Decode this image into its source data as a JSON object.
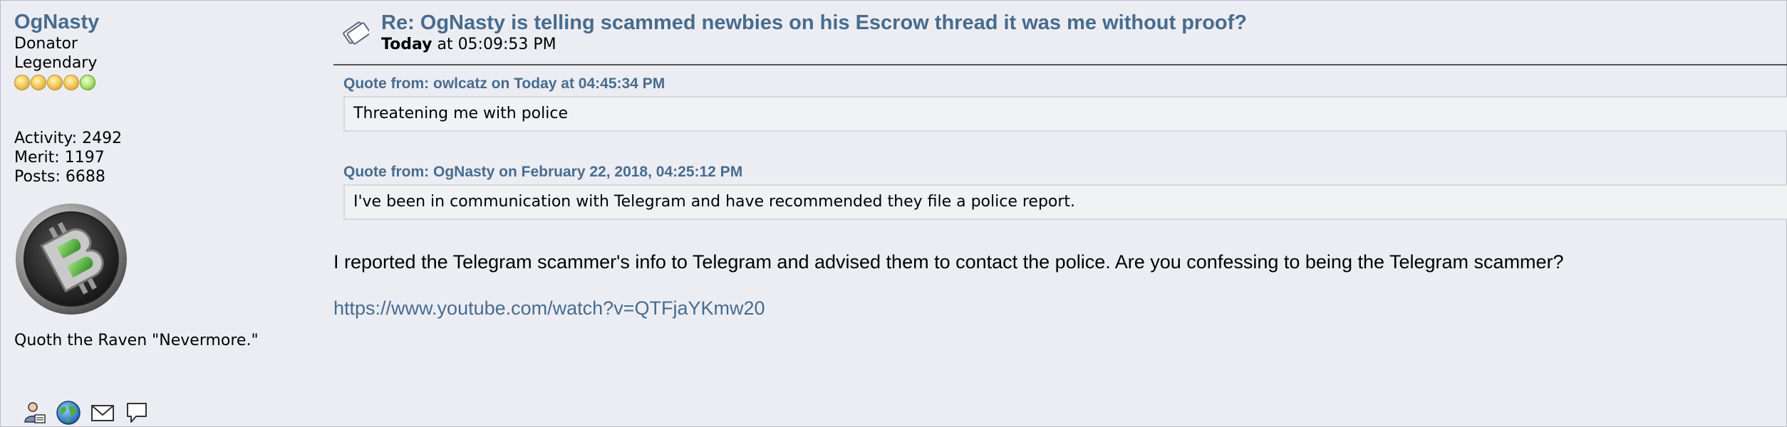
{
  "poster": {
    "name": "OgNasty",
    "group": "Donator",
    "rank": "Legendary",
    "rank_icons": [
      "gold-star-icon",
      "gold-star-icon",
      "gold-star-icon",
      "gold-star-icon",
      "green-star-icon"
    ],
    "activity": "Activity: 2492",
    "merit": "Merit: 1197",
    "posts": "Posts: 6688",
    "avatar_icon": "bitcoin-avatar",
    "personal_text": "Quoth the Raven \"Nevermore.\"",
    "action_icons": [
      "profile-icon",
      "website-globe-icon",
      "email-envelope-icon",
      "message-bubble-icon"
    ]
  },
  "post": {
    "icon": "post-xx-icon",
    "subject": "Re: OgNasty is telling scammed newbies on his Escrow thread it was me without proof?",
    "time_bold": "Today",
    "time_rest": " at 05:09:53 PM",
    "quotes": [
      {
        "header": "Quote from: owlcatz on Today at 04:45:34 PM",
        "text": "Threatening me with police"
      },
      {
        "header": "Quote from: OgNasty on February 22, 2018, 04:25:12 PM",
        "text": "I've been in communication with Telegram and have recommended they file a police report."
      }
    ],
    "body": "I reported the Telegram scammer's info to Telegram and advised them to contact the police.  Are you confessing to being the Telegram scammer?",
    "link": "https://www.youtube.com/watch?v=QTFjaYKmw20"
  },
  "colors": {
    "background": "#ecedf3",
    "link": "#476c8e",
    "quote_bg": "#f1f2f4",
    "quote_border": "#d4d8e0"
  }
}
